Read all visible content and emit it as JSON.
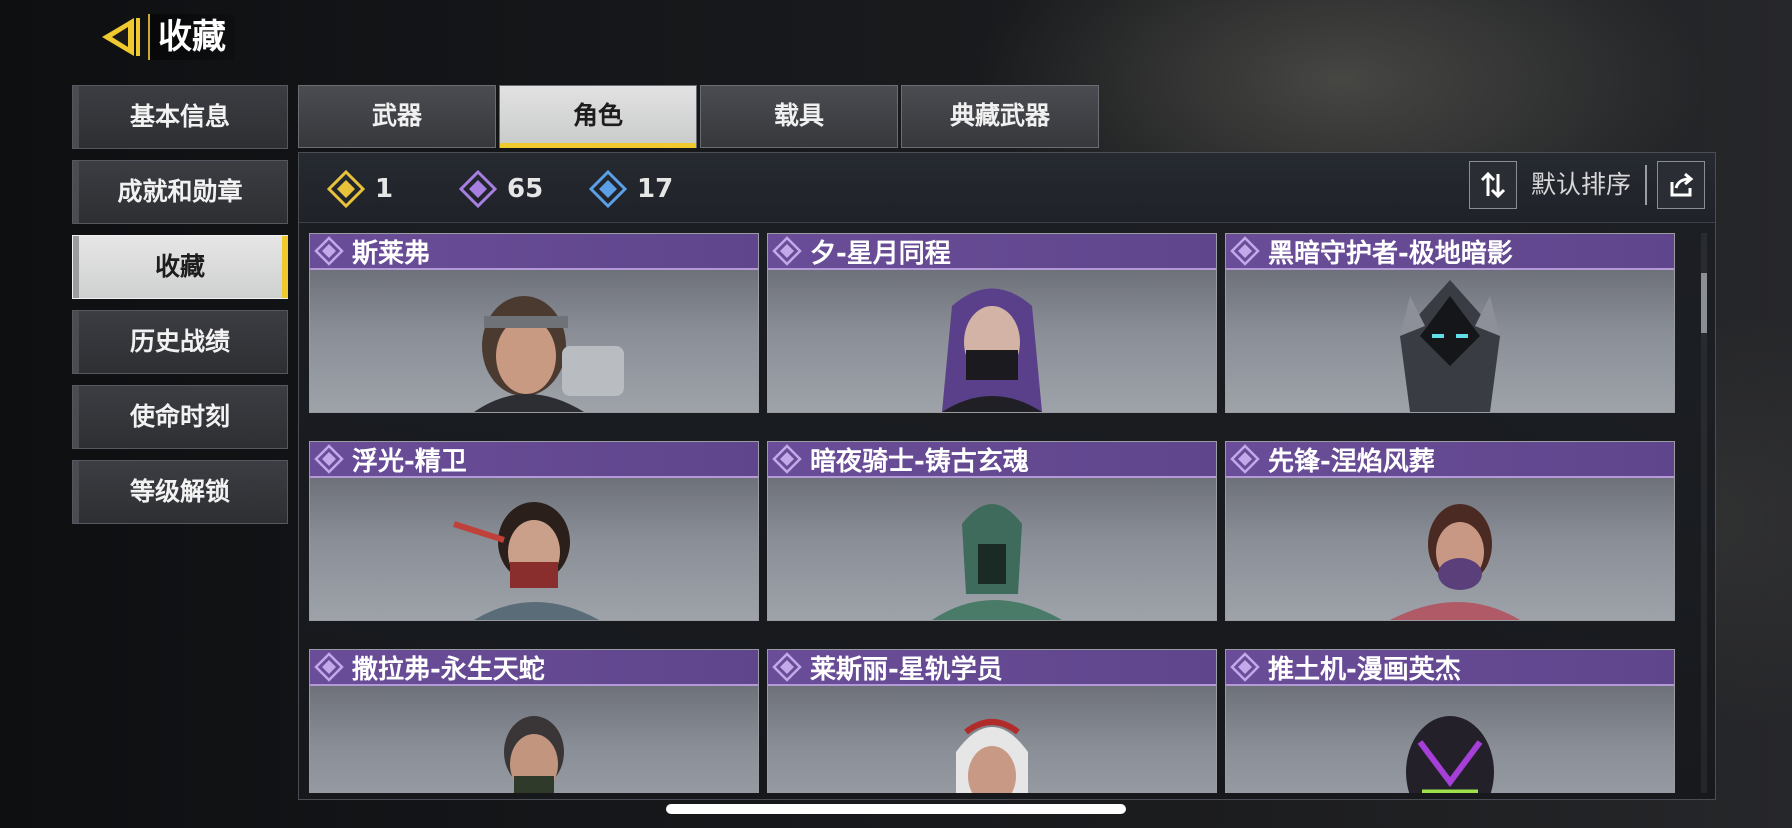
{
  "header": {
    "title": "收藏"
  },
  "sidebar": {
    "items": [
      {
        "label": "基本信息"
      },
      {
        "label": "成就和勋章"
      },
      {
        "label": "收藏"
      },
      {
        "label": "历史战绩"
      },
      {
        "label": "使命时刻"
      },
      {
        "label": "等级解锁"
      }
    ],
    "active_index": 2
  },
  "tabs": [
    {
      "label": "武器"
    },
    {
      "label": "角色"
    },
    {
      "label": "载具"
    },
    {
      "label": "典藏武器"
    }
  ],
  "active_tab": 1,
  "counters": [
    {
      "icon": "gold-diamond-icon",
      "value": "1",
      "color": "#e7c23b"
    },
    {
      "icon": "purple-diamond-icon",
      "value": "65",
      "color": "#a77fe0"
    },
    {
      "icon": "blue-diamond-icon",
      "value": "17",
      "color": "#5b9fe6"
    }
  ],
  "sort": {
    "label": "默认排序",
    "icon": "swap-vertical-icon",
    "share_icon": "share-icon"
  },
  "cards": [
    {
      "name": "斯莱弗",
      "rarity": "purple"
    },
    {
      "name": "夕-星月同程",
      "rarity": "purple"
    },
    {
      "name": "黑暗守护者-极地暗影",
      "rarity": "purple"
    },
    {
      "name": "浮光-精卫",
      "rarity": "purple"
    },
    {
      "name": "暗夜骑士-铸古玄魂",
      "rarity": "purple"
    },
    {
      "name": "先锋-涅焰风葬",
      "rarity": "purple"
    },
    {
      "name": "撒拉弗-永生天蛇",
      "rarity": "purple"
    },
    {
      "name": "莱斯丽-星轨学员",
      "rarity": "purple"
    },
    {
      "name": "推土机-漫画英杰",
      "rarity": "purple"
    }
  ],
  "colors": {
    "accent": "#f0c92e",
    "rarity_purple": "#6a4d98"
  }
}
